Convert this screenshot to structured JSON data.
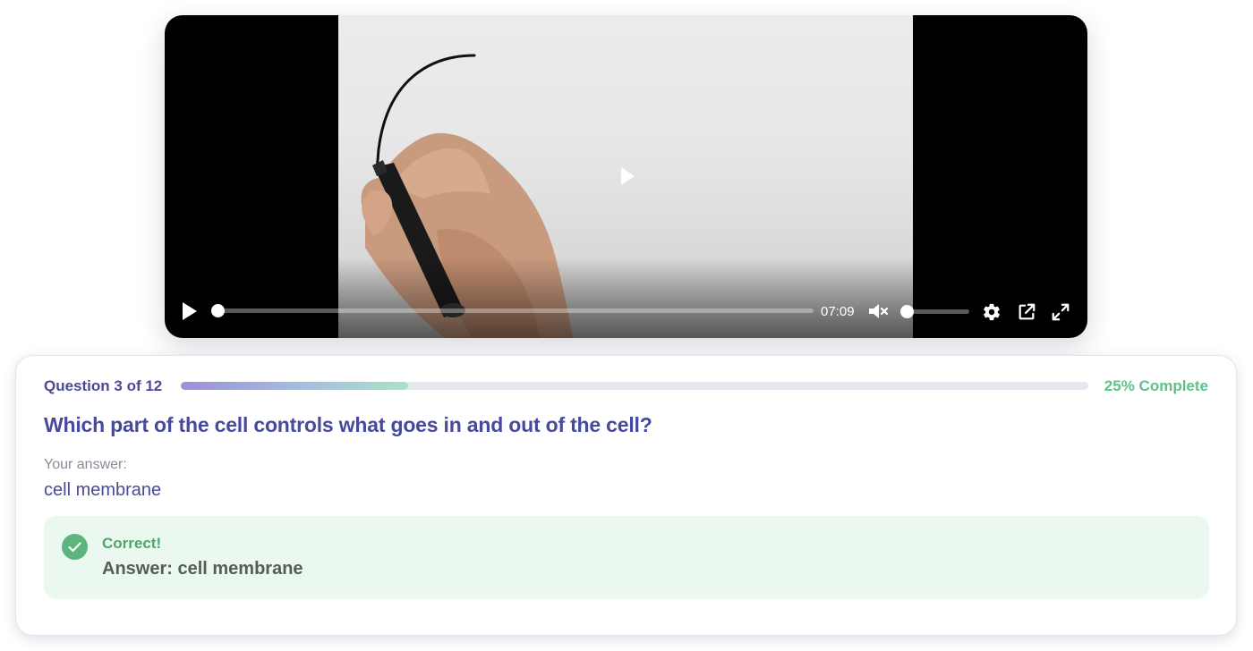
{
  "video": {
    "current_time": "07:09",
    "progress_fraction": 0.0,
    "volume_fraction": 0.0,
    "muted": true,
    "icons": {
      "center_play": "play-icon",
      "play": "play-icon",
      "mute": "volume-muted-icon",
      "settings": "gear-icon",
      "popout": "external-link-icon",
      "fullscreen": "fullscreen-icon"
    }
  },
  "quiz": {
    "question_count": "Question 3 of 12",
    "progress_fraction": 0.25,
    "complete_text": "25% Complete",
    "question": "Which part of the cell controls what goes in and out of the cell?",
    "answer_label": "Your answer:",
    "answer_value": "cell membrane",
    "feedback": {
      "status": "Correct!",
      "answer": "Answer: cell membrane",
      "icon": "check-circle-icon"
    }
  },
  "colors": {
    "title": "#474a9c",
    "complete": "#5fbf8d",
    "feedback_bg": "#ebf8ef",
    "feedback_status": "#4ea56d",
    "check": "#5cb57d"
  }
}
